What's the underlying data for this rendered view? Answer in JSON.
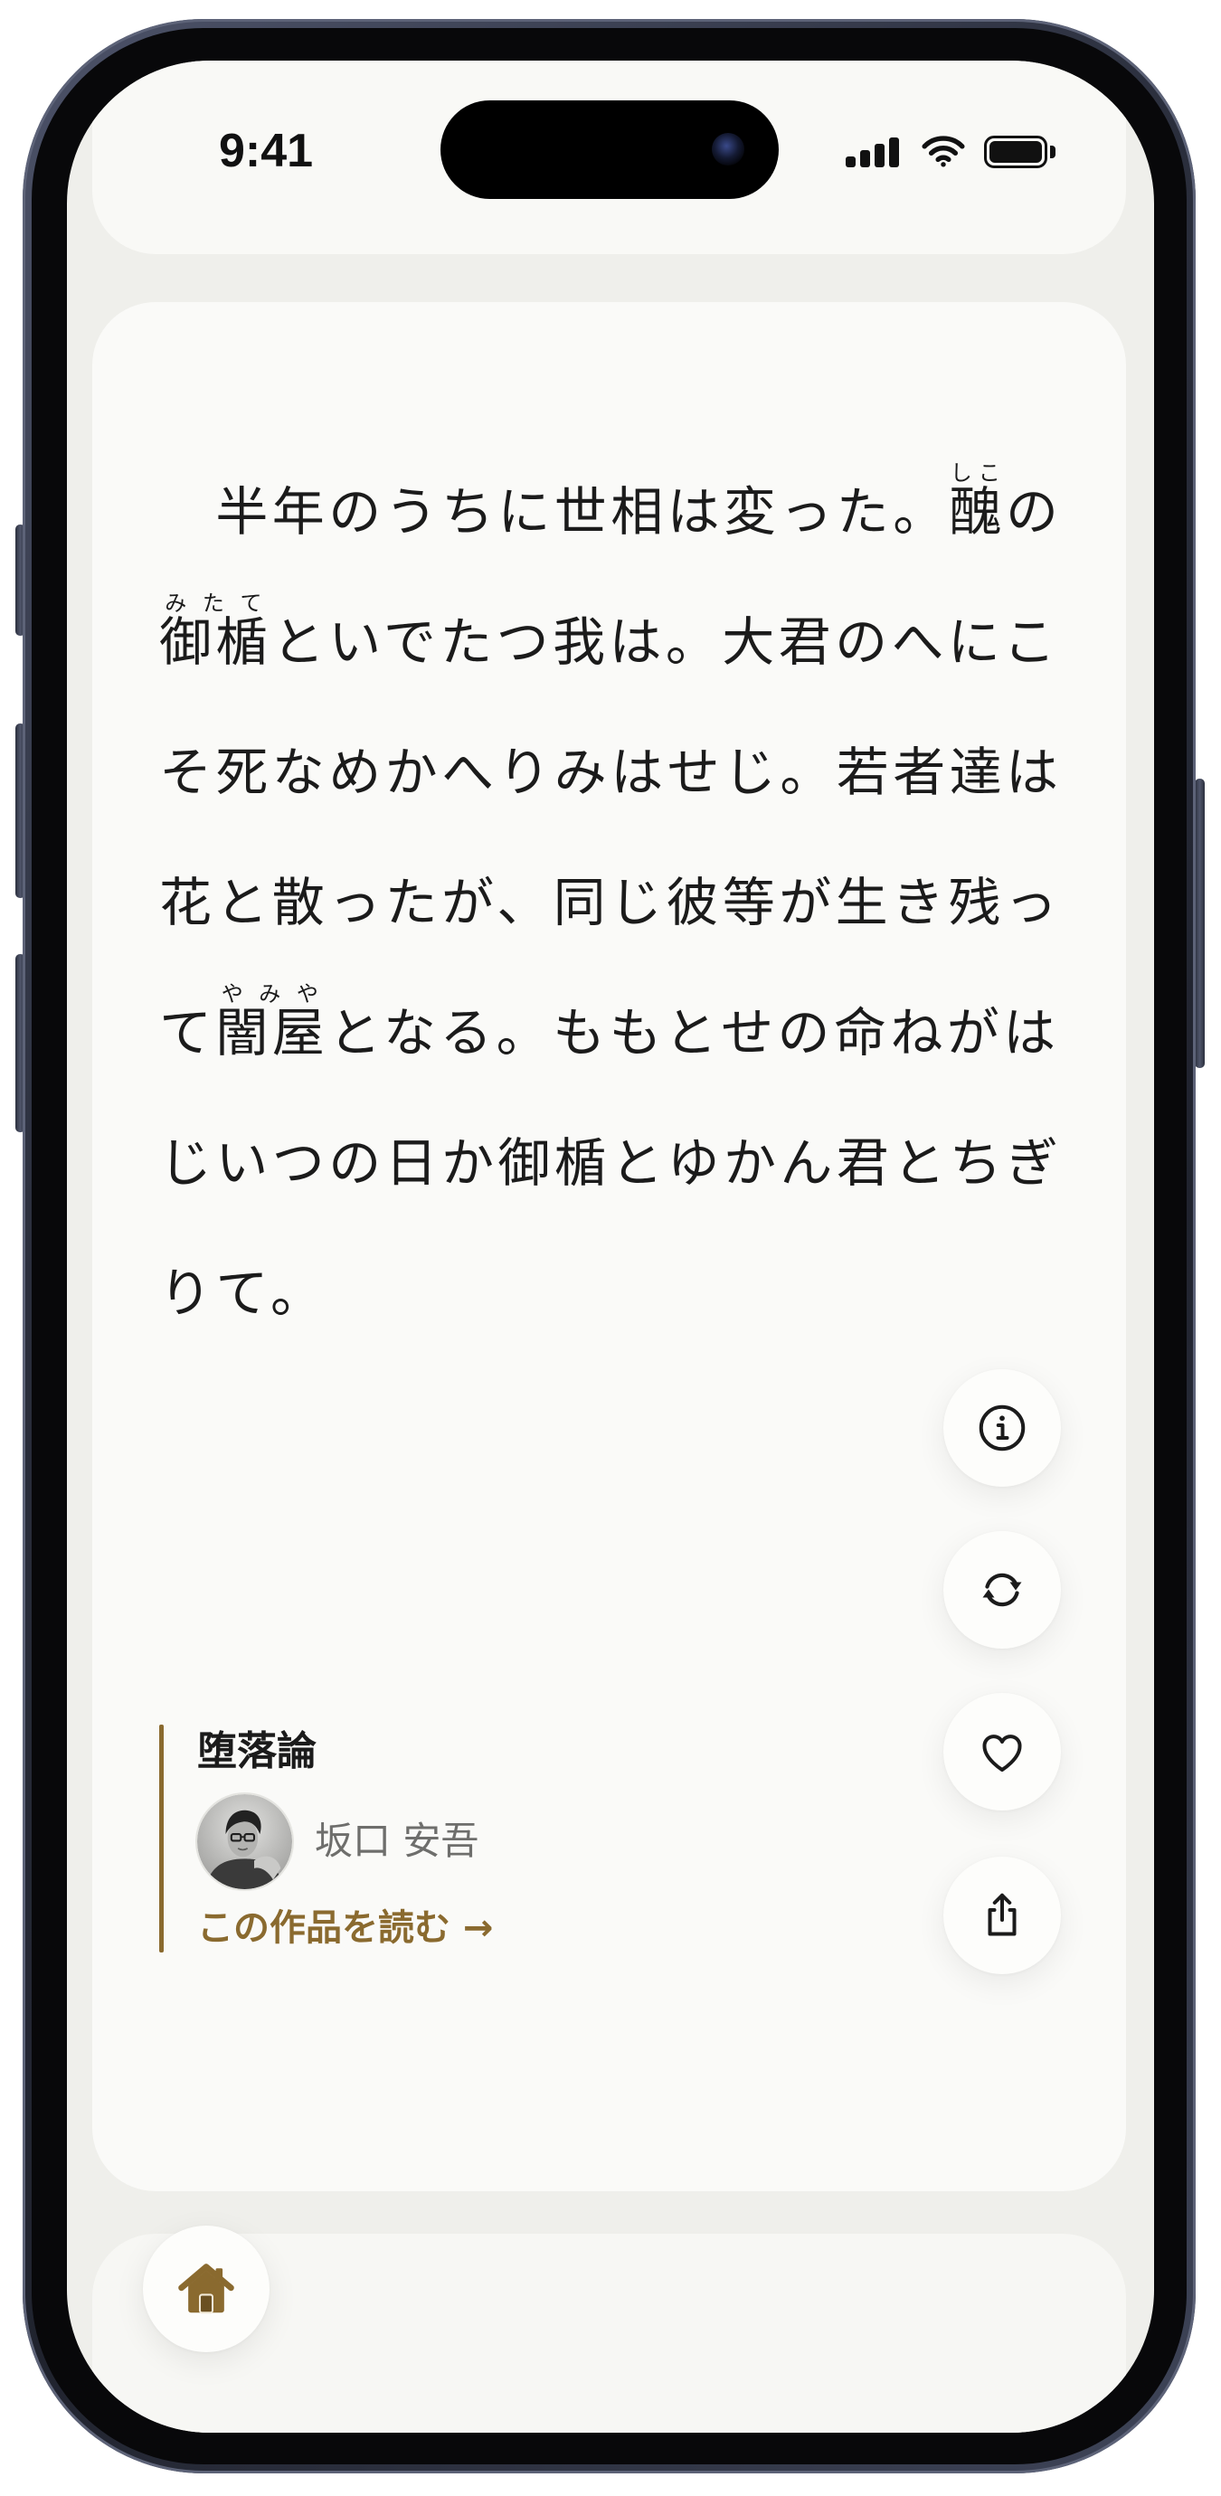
{
  "status_bar": {
    "time": "9:41",
    "icons": [
      "signal-icon",
      "wifi-icon",
      "battery-icon"
    ],
    "battery_level": 1.0
  },
  "passage": {
    "lines": [
      [
        {
          "text": "　半年のうちに世相は変った。"
        },
        {
          "text": "醜",
          "ruby": "しこ"
        },
        {
          "text": "の"
        }
      ],
      [
        {
          "text": "御楯",
          "ruby": "みたて"
        },
        {
          "text": "といでたつ我は。大君のへにこ"
        }
      ],
      [
        {
          "text": "そ死なめかへりみはせじ。若者達は"
        }
      ],
      [
        {
          "text": "花と散ったが、同じ彼等が生き残っ"
        }
      ],
      [
        {
          "text": "て"
        },
        {
          "text": "闇屋",
          "ruby": "やみや"
        },
        {
          "text": "となる。ももとせの命ねがは"
        }
      ],
      [
        {
          "text": "じいつの日か御楯とゆかん君とちぎ"
        }
      ],
      [
        {
          "text": "りて。"
        }
      ]
    ]
  },
  "actions": {
    "icons": [
      "info-icon",
      "refresh-icon",
      "heart-icon",
      "share-icon"
    ]
  },
  "work": {
    "title": "堕落論",
    "author": "坂口 安吾",
    "link_label": "この作品を読む →"
  },
  "nav": {
    "home_icon": "home-icon"
  },
  "colors": {
    "accent": "#8a6a2f",
    "text": "#1b1b1b",
    "author_text": "#6e6e6c",
    "card": "#fafaf8",
    "screen": "#efefeb",
    "button": "#fdfdfb"
  }
}
